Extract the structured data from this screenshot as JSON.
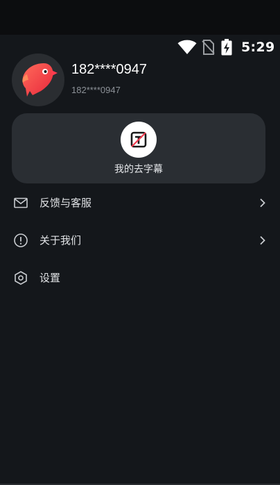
{
  "status_bar": {
    "time": "5:29",
    "icons": [
      "wifi-icon",
      "no-sim-icon",
      "battery-charging-icon"
    ]
  },
  "profile": {
    "name": "182****0947",
    "subtitle": "182****0947",
    "avatar_icon": "parrot-avatar-icon"
  },
  "card": {
    "label": "我的去字幕",
    "icon": "subtitle-remove-icon"
  },
  "menu": {
    "items": [
      {
        "label": "反馈与客服",
        "icon": "mail-icon",
        "has_chevron": true
      },
      {
        "label": "关于我们",
        "icon": "info-circle-icon",
        "has_chevron": true
      },
      {
        "label": "设置",
        "icon": "settings-hexagon-icon",
        "has_chevron": false
      }
    ]
  },
  "colors": {
    "background": "#14171b",
    "card": "#2a2e33",
    "avatar_accent": "#ff4d5a",
    "secondary_text": "#8d9298"
  }
}
